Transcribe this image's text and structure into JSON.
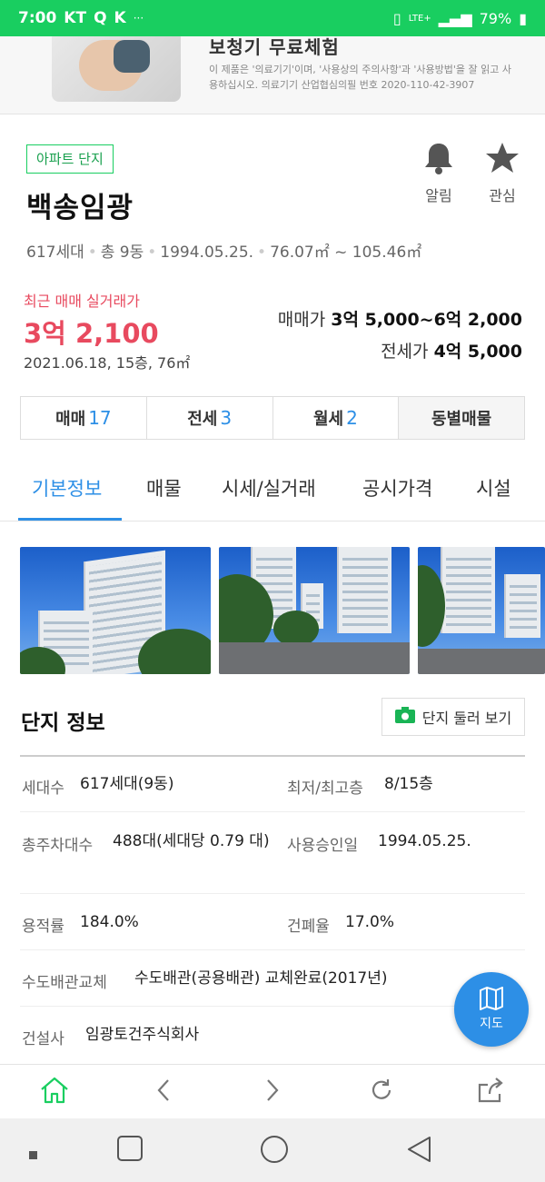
{
  "status": {
    "time": "7:00",
    "carrier": "KT",
    "battery": "79%",
    "network": "LTE+",
    "dots": "···"
  },
  "ad": {
    "title": "보청기 무료체험",
    "desc": "이 제품은 '의료기기'이며, '사용상의 주의사항'과 '사용방법'을 잘 읽고 사용하십시오. 의료기기 산업협심의필 번호 2020-110-42-3907"
  },
  "complex": {
    "tag": "아파트 단지",
    "name": "백송임광",
    "meta": [
      "617세대",
      "총 9동",
      "1994.05.25.",
      "76.07㎡ ~ 105.46㎡"
    ],
    "alarm_label": "알림",
    "favorite_label": "관심"
  },
  "price": {
    "recent_label": "최근 매매 실거래가",
    "recent_value": "3억 2,100",
    "recent_date": "2021.06.18, 15층, 76㎡",
    "sale_label": "매매가",
    "sale_value": "3억 5,000~6억 2,000",
    "jeonse_label": "전세가",
    "jeonse_value": "4억 5,000"
  },
  "listing_tabs": [
    {
      "label": "매매",
      "count": "17"
    },
    {
      "label": "전세",
      "count": "3"
    },
    {
      "label": "월세",
      "count": "2"
    },
    {
      "label": "동별매물",
      "count": ""
    }
  ],
  "section_tabs": [
    "기본정보",
    "매물",
    "시세/실거래",
    "공시가격",
    "시설"
  ],
  "info": {
    "title": "단지 정보",
    "tour_label": "단지 둘러 보기",
    "households_label": "세대수",
    "households_value": "617세대(9동)",
    "floors_label": "최저/최고층",
    "floors_value": "8/15층",
    "parking_label": "총주차대수",
    "parking_value": "488대(세대당 0.79 대)",
    "approval_label": "사용승인일",
    "approval_value": "1994.05.25.",
    "far_label": "용적률",
    "far_value": "184.0%",
    "bcr_label": "건폐율",
    "bcr_value": "17.0%",
    "pipe_label": "수도배관교체",
    "pipe_value": "수도배관(공용배관) 교체완료(2017년)",
    "builder_label": "건설사",
    "builder_value": "임광토건주식회사"
  },
  "map_label": "지도",
  "colors": {
    "naver_green": "#19ce60",
    "accent_blue": "#2d8fe6",
    "price_red": "#e84a5f"
  }
}
